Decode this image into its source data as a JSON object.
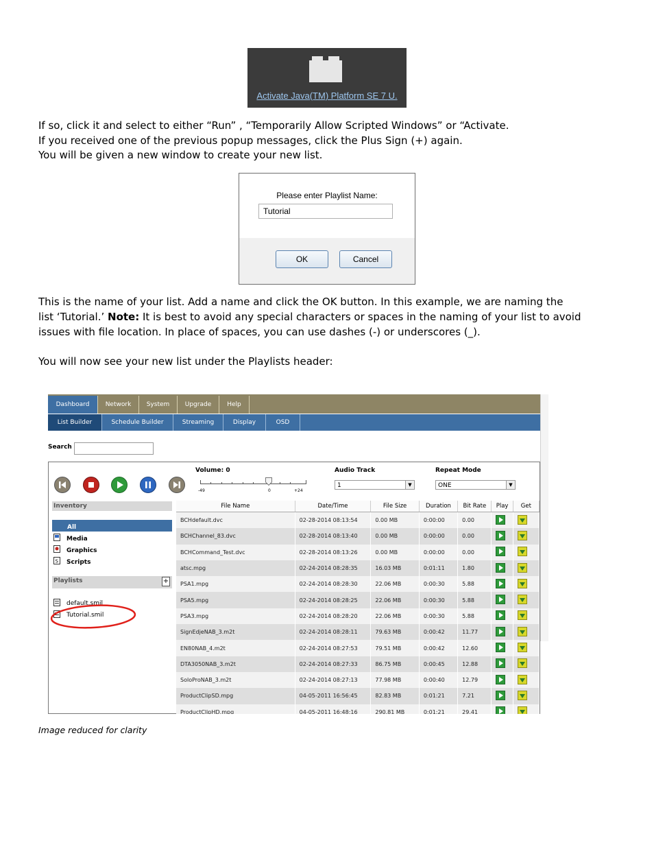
{
  "java_prompt": {
    "link_text": "Activate Java(TM) Platform SE 7 U."
  },
  "para1": {
    "line1": "If so, click it and select to either “Run” , “Temporarily Allow Scripted Windows” or “Activate.",
    "line2": "If you received one of the previous popup messages, click the Plus Sign (+) again.",
    "line3": "You will be given a new window to create your new list."
  },
  "dialog": {
    "label": "Please enter Playlist Name:",
    "input_value": "Tutorial",
    "ok_label": "OK",
    "cancel_label": "Cancel"
  },
  "para2": {
    "line1": "This is the name of your list.  Add a name and click the OK button.  In this example, we are naming the",
    "line2_pre": "list ‘Tutorial.’  ",
    "line2_bold": "Note:",
    "line2_post": " It is best to avoid any special characters or spaces in the naming of your list to avoid",
    "line3": "issues with file location.  In place of spaces, you can use dashes (-) or underscores (_)."
  },
  "para3": {
    "line1": "You will now see your new list under the Playlists header:"
  },
  "app": {
    "top_nav": [
      "Dashboard",
      "Network",
      "System",
      "Upgrade",
      "Help"
    ],
    "sub_nav": [
      "List Builder",
      "Schedule Builder",
      "Streaming",
      "Display",
      "OSD"
    ],
    "search_label": "Search",
    "volume_label": "Volume: 0",
    "volume_min": "-49",
    "volume_mid": "0",
    "volume_max": "+24",
    "volume_value": 0,
    "audio_track_label": "Audio Track",
    "audio_track_value": "1",
    "repeat_mode_label": "Repeat Mode",
    "repeat_mode_value": "ONE",
    "inventory_header": "Inventory",
    "inventory_items": [
      "All",
      "Media",
      "Graphics",
      "Scripts"
    ],
    "playlists_header": "Playlists",
    "playlists": [
      "default.smil",
      "Tutorial.smil"
    ],
    "table_headers": [
      "File Name",
      "Date/Time",
      "File Size",
      "Duration",
      "Bit Rate",
      "Play",
      "Get"
    ],
    "rows": [
      [
        "BCHdefault.dvc",
        "02-28-2014  08:13:54",
        "0.00 MB",
        "0:00:00",
        "0.00"
      ],
      [
        "BCHChannel_83.dvc",
        "02-28-2014  08:13:40",
        "0.00 MB",
        "0:00:00",
        "0.00"
      ],
      [
        "BCHCommand_Test.dvc",
        "02-28-2014  08:13:26",
        "0.00 MB",
        "0:00:00",
        "0.00"
      ],
      [
        "atsc.mpg",
        "02-24-2014  08:28:35",
        "16.03 MB",
        "0:01:11",
        "1.80"
      ],
      [
        "PSA1.mpg",
        "02-24-2014  08:28:30",
        "22.06 MB",
        "0:00:30",
        "5.88"
      ],
      [
        "PSA5.mpg",
        "02-24-2014  08:28:25",
        "22.06 MB",
        "0:00:30",
        "5.88"
      ],
      [
        "PSA3.mpg",
        "02-24-2014  08:28:20",
        "22.06 MB",
        "0:00:30",
        "5.88"
      ],
      [
        "SignEdjeNAB_3.m2t",
        "02-24-2014  08:28:11",
        "79.63 MB",
        "0:00:42",
        "11.77"
      ],
      [
        "EN80NAB_4.m2t",
        "02-24-2014  08:27:53",
        "79.51 MB",
        "0:00:42",
        "12.60"
      ],
      [
        "DTA3050NAB_3.m2t",
        "02-24-2014  08:27:33",
        "86.75 MB",
        "0:00:45",
        "12.88"
      ],
      [
        "SoloProNAB_3.m2t",
        "02-24-2014  08:27:13",
        "77.98 MB",
        "0:00:40",
        "12.79"
      ],
      [
        "ProductClipSD.mpg",
        "04-05-2011  16:56:45",
        "82.83 MB",
        "0:01:21",
        "7.21"
      ],
      [
        "ProductClipHD.mpg",
        "04-05-2011  16:48:16",
        "290.81 MB",
        "0:01:21",
        "29.41"
      ]
    ]
  },
  "caption": "Image reduced for clarity"
}
